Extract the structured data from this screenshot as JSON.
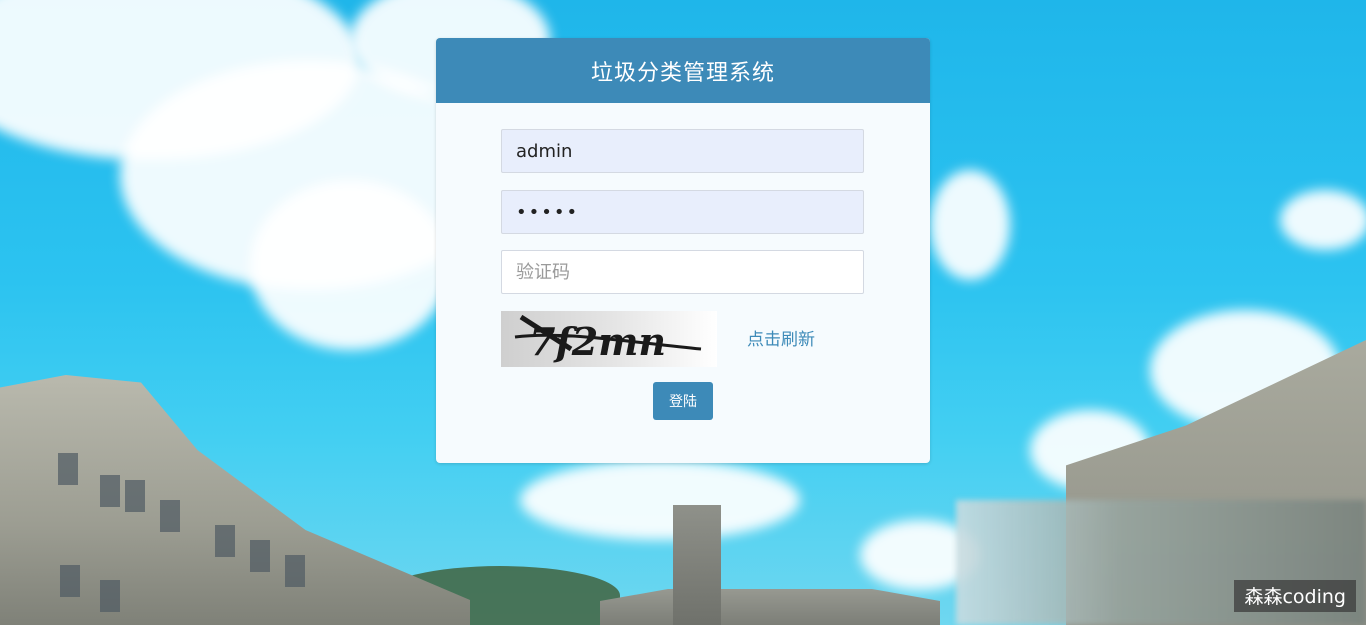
{
  "login": {
    "title": "垃圾分类管理系统",
    "username_value": "admin",
    "password_value": "•••••",
    "captcha_placeholder": "验证码",
    "captcha_text": "7f2mn",
    "refresh_label": "点击刷新",
    "login_label": "登陆"
  },
  "watermark": "森森coding",
  "colors": {
    "header": "#3d8ab8",
    "filled_input": "#e8eefc",
    "link": "#3d8ab8"
  }
}
